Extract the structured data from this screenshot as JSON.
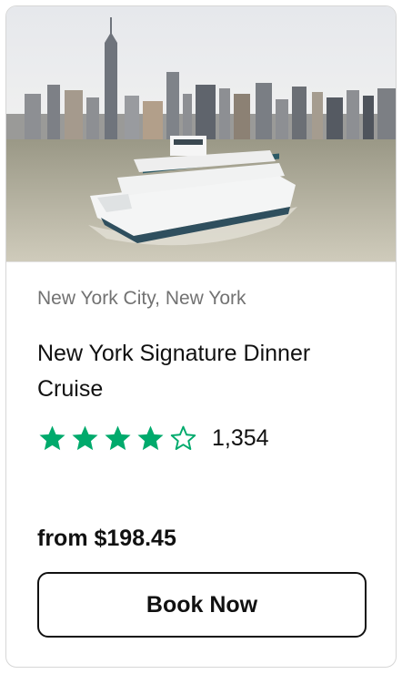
{
  "card": {
    "image_alt": "Cruise ship on the Hudson River with Manhattan skyline",
    "location": "New York City, New York",
    "title": "New York Signature Dinner Cruise",
    "rating": {
      "value": 4,
      "max": 5,
      "review_count": "1,354"
    },
    "price": "from $198.45",
    "cta_label": "Book Now"
  },
  "colors": {
    "star_filled": "#00aa6c",
    "star_empty_outline": "#00aa6c",
    "text_primary": "#111111",
    "text_secondary": "#727272",
    "card_border": "#d6d6d6"
  }
}
